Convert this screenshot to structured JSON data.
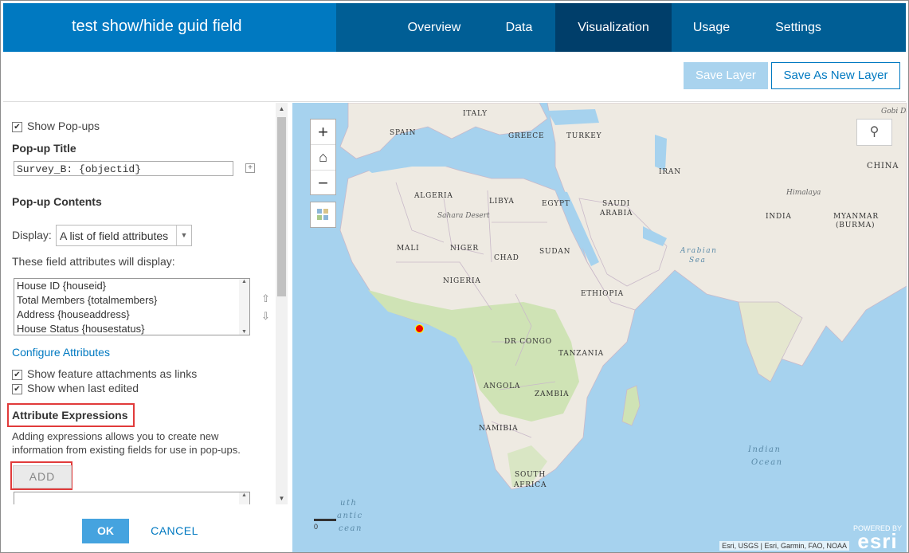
{
  "app_title": "test show/hide guid field",
  "nav": {
    "tabs": [
      "Overview",
      "Data",
      "Visualization",
      "Usage",
      "Settings"
    ],
    "active": "Visualization"
  },
  "toolbar": {
    "save_label": "Save Layer",
    "save_as_label": "Save As New Layer"
  },
  "panel": {
    "show_popups_label": "Show Pop-ups",
    "popup_title_heading": "Pop-up Title",
    "popup_title_value": "Survey_B: {objectid}",
    "popup_contents_heading": "Pop-up Contents",
    "display_label": "Display:",
    "display_value": "A list of field attributes",
    "fields_display_label": "These field attributes will display:",
    "field_items": [
      "House ID {houseid}",
      "Total Members {totalmembers}",
      "Address {houseaddress}",
      "House Status {housestatus}"
    ],
    "configure_link": "Configure Attributes",
    "attachments_label": "Show feature attachments as links",
    "last_edited_label": "Show when last edited",
    "attr_expr_heading": "Attribute Expressions",
    "attr_expr_desc_1": "Adding expressions allows you to create new",
    "attr_expr_desc_2": "information from existing fields for use in pop-ups.",
    "add_label": "ADD",
    "ok_label": "OK",
    "cancel_label": "CANCEL"
  },
  "map": {
    "labels": {
      "spain": "SPAIN",
      "italy": "ITALY",
      "greece": "GREECE",
      "turkey": "TURKEY",
      "algeria": "ALGERIA",
      "libya": "LIBYA",
      "egypt": "EGYPT",
      "saudi1": "SAUDI",
      "saudi2": "ARABIA",
      "iran": "IRAN",
      "china": "CHINA",
      "india": "INDIA",
      "myanmar1": "MYANMAR",
      "myanmar2": "(BURMA)",
      "sahara": "Sahara Desert",
      "himalaya": "Himalaya",
      "gobi": "Gobi De",
      "mali": "MALI",
      "niger": "NIGER",
      "chad": "CHAD",
      "sudan": "SUDAN",
      "nigeria": "NIGERIA",
      "ethiopia": "ETHIOPIA",
      "drc": "DR CONGO",
      "tanzania": "TANZANIA",
      "angola": "ANGOLA",
      "zambia": "ZAMBIA",
      "namibia": "NAMIBIA",
      "sa1": "SOUTH",
      "sa2": "AFRICA",
      "arabian1": "Arabian",
      "arabian2": "Sea",
      "indian1": "Indian",
      "indian2": "Ocean",
      "south_atl1": "uth",
      "south_atl2": "antic",
      "south_atl3": "cean"
    },
    "attribution": "Esri, USGS | Esri, Garmin, FAO, NOAA",
    "esri_powered": "POWERED BY",
    "esri_brand": "esri",
    "scale_zero": "0",
    "colors": {
      "water": "#a6d2ee",
      "land": "#eeeae2",
      "vegetation": "#cfe3b5",
      "accent": "#0079c1"
    }
  }
}
